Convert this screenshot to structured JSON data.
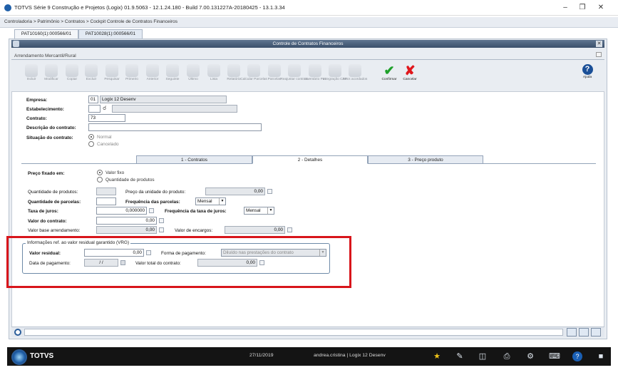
{
  "window": {
    "title": "TOTVS Série 9 Construção e Projetos (Logix) 01.9.5063  -  12.1.24.180 - Build 7.00.131227A-20180425 - 13.1.3.34"
  },
  "breadcrumb": "Controladoria > Patrimônio > Contratos > Cockpit Controle de Contratos Financeiros",
  "doc_tabs": [
    "PAT10160(1):000566/01",
    "PAT10028(1):000566/01"
  ],
  "form": {
    "title": "Controle de Contratos Financeiros",
    "subtitle": "Arrendamento Mercantil/Rural"
  },
  "toolbar": [
    {
      "label": "Incluir",
      "icon": "add-icon"
    },
    {
      "label": "Modificar",
      "icon": "edit-icon"
    },
    {
      "label": "Copiar",
      "icon": "copy-icon"
    },
    {
      "label": "Excluir",
      "icon": "delete-icon"
    },
    {
      "label": "Pesquisar",
      "icon": "search-icon"
    },
    {
      "label": "Primeiro",
      "icon": "first-icon"
    },
    {
      "label": "Anterior",
      "icon": "previous-icon"
    },
    {
      "label": "Seguinte",
      "icon": "next-icon"
    },
    {
      "label": "Último",
      "icon": "last-icon"
    },
    {
      "label": "Lista",
      "icon": "list-icon"
    },
    {
      "label": "Relatório",
      "icon": "report-icon"
    },
    {
      "label": "Calcular Parcelas",
      "icon": "calculator-icon"
    },
    {
      "label": "Parcelas",
      "icon": "installments-icon"
    },
    {
      "label": "Reajustar contrato",
      "icon": "percent-icon"
    },
    {
      "label": "Inventário Pat",
      "icon": "inventory-icon"
    },
    {
      "label": "Integração CAP",
      "icon": "integration-icon"
    },
    {
      "label": "Docs acordados",
      "icon": "documents-icon"
    }
  ],
  "actions": {
    "confirm": "Confirmar",
    "cancel": "Cancelar",
    "help": "Ajuda"
  },
  "header_fields": {
    "empresa_label": "Empresa:",
    "empresa_code": "01",
    "empresa_name": "Logix 12 Desenv",
    "estabelecimento_label": "Estabelecimento:",
    "contrato_label": "Contrato:",
    "contrato_value": "73",
    "descricao_label": "Descrição do contrato:",
    "situacao_label": "Situação do contrato:",
    "situacao_normal": "Normal",
    "situacao_cancelado": "Cancelado"
  },
  "detail_tabs": [
    "1 - Contratos",
    "2 - Detalhes",
    "3 - Preço produto"
  ],
  "details": {
    "preco_fixado_label": "Preço fixado em:",
    "preco_valor_fixo": "Valor fixo",
    "preco_quantidade": "Quantidade de produtos",
    "qtd_produtos_label": "Quantidade de produtos:",
    "preco_unidade_label": "Preço da unidade do produto:",
    "preco_unidade_value": "0,00",
    "qtd_parcelas_label": "Quantidade de parcelas:",
    "freq_parcelas_label": "Frequência das parcelas:",
    "freq_parcelas_value": "Mensal",
    "taxa_juros_label": "Taxa de juros:",
    "taxa_juros_value": "0,000000",
    "freq_taxa_label": "Frequência da taxa de juros:",
    "freq_taxa_value": "Mensal",
    "valor_contrato_label": "Valor do contrato:",
    "valor_contrato_value": "0,00",
    "valor_base_label": "Valor base arrendamento:",
    "valor_base_value": "0,00",
    "valor_encargos_label": "Valor de encargos:",
    "valor_encargos_value": "0,00"
  },
  "vrg": {
    "title": "Informações ref. ao valor residual garantido (VRG)",
    "valor_residual_label": "Valor residual:",
    "valor_residual_value": "0,00",
    "forma_pagamento_label": "Forma de pagamento:",
    "forma_pagamento_value": "Diluído nas prestações do contrato",
    "data_pagamento_label": "Data de pagamento:",
    "data_pagamento_value": "/ /",
    "valor_total_label": "Valor total do contrato:",
    "valor_total_value": "0,00"
  },
  "taskbar": {
    "brand": "TOTVS",
    "date": "27/11/2019",
    "user": "andrea.cristina | Logix 12 Desenv"
  },
  "colors": {
    "header": "#3b506b",
    "highlight": "#d8151b",
    "taskbar": "#141414"
  }
}
